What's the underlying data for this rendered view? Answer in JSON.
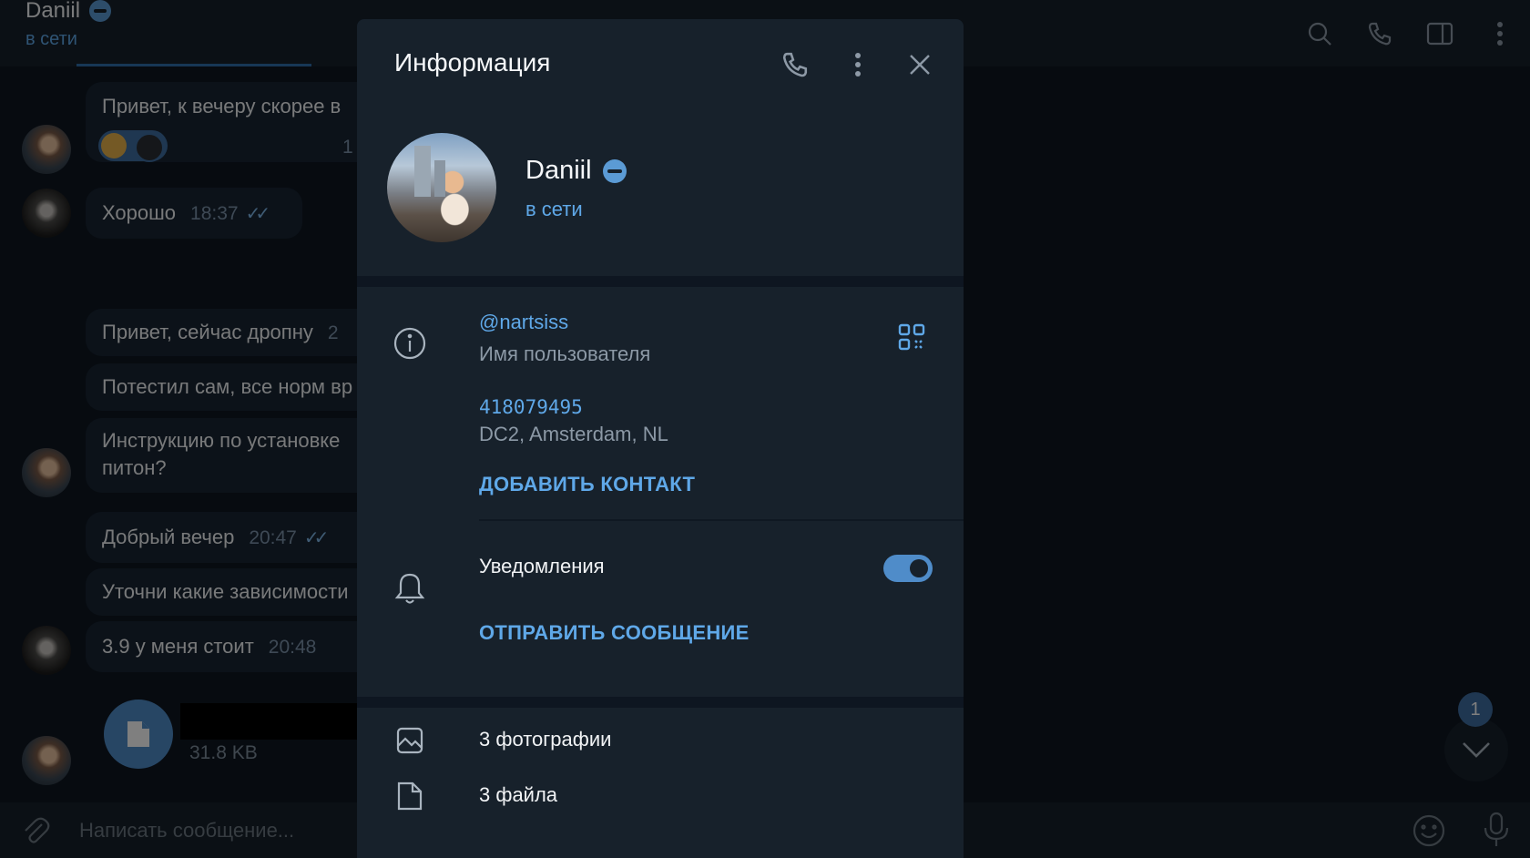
{
  "chat": {
    "title": "Daniil",
    "status": "в сети",
    "composer_placeholder": "Написать сообщение...",
    "unread_count": "1",
    "messages": [
      {
        "text": "Привет, к вечеру скорее в",
        "time": "1"
      },
      {
        "text": "Хорошо",
        "time": "18:37"
      },
      {
        "text": "Привет, сейчас дропну",
        "time": "2"
      },
      {
        "text": "Потестил сам, все норм вр",
        "time": ""
      },
      {
        "text": "Инструкцию по установке",
        "text2": "питон?"
      },
      {
        "text": "Добрый вечер",
        "time": "20:47"
      },
      {
        "text": "Уточни какие зависимости",
        "time": ""
      },
      {
        "text": "3.9 у меня стоит",
        "time": "20:48"
      }
    ],
    "file_size": "31.8 KB"
  },
  "panel": {
    "title": "Информация",
    "profile": {
      "name": "Daniil",
      "status": "в сети"
    },
    "info": {
      "username": "@nartsiss",
      "username_label": "Имя пользователя",
      "user_id": "418079495",
      "dc": "DC2, Amsterdam, NL",
      "add_contact": "ДОБАВИТЬ КОНТАКТ"
    },
    "notifications": {
      "label": "Уведомления",
      "enabled": true,
      "send_message": "ОТПРАВИТЬ СООБЩЕНИЕ"
    },
    "media": {
      "photos": "3 фотографии",
      "files": "3 файла"
    }
  },
  "colors": {
    "accent": "#5fa8e8",
    "panel_bg": "#17212b",
    "app_bg": "#0e1621"
  }
}
